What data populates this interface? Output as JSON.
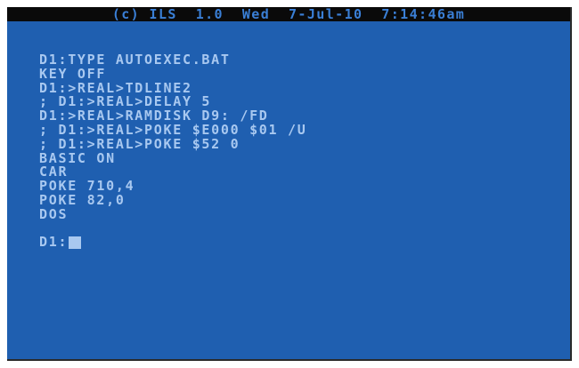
{
  "status_bar": {
    "text": "(c) ILS  1.0  Wed  7-Jul-10  7:14:46am"
  },
  "terminal": {
    "lines": [
      "D1:TYPE AUTOEXEC.BAT",
      "KEY OFF",
      "D1:>REAL>TDLINE2",
      "; D1:>REAL>DELAY 5",
      "D1:>REAL>RAMDISK D9: /FD",
      "; D1:>REAL>POKE $E000 $01 /U",
      "; D1:>REAL>POKE $52 0",
      "BASIC ON",
      "CAR",
      "POKE 710,4",
      "POKE 82,0",
      "DOS"
    ],
    "prompt": "D1:"
  },
  "colors": {
    "screen_background": "#1f5fb0",
    "text": "#a8c8f0",
    "status_bar_background": "#0a0a0a",
    "status_bar_text": "#3a7fd6"
  }
}
